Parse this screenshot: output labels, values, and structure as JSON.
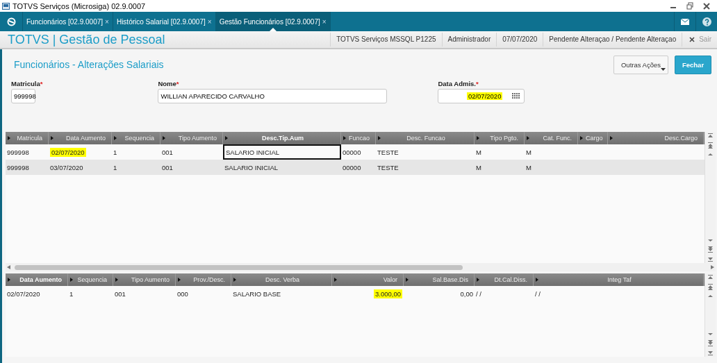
{
  "window": {
    "title": "TOTVS Serviços (Microsiga) 02.9.0007"
  },
  "tabs": [
    {
      "label": "Funcionários [02.9.0007]",
      "close": "×",
      "selected": false
    },
    {
      "label": "Histórico Salarial [02.9.0007]",
      "close": "×",
      "selected": false
    },
    {
      "label": "Gestão Funcionários [02.9.0007]",
      "close": "×",
      "selected": true
    }
  ],
  "app_header": {
    "title": "TOTVS | Gestão de Pessoal",
    "info": [
      "TOTVS Serviços MSSQL P1225",
      "Administrador",
      "07/07/2020",
      "Pendente Alteraçao / Pendente Alteraçao"
    ],
    "exit": "Sair"
  },
  "page": {
    "title": "Funcionários - Alterações Salariais",
    "buttons": [
      {
        "label": "Outras Ações",
        "kind": "menu"
      },
      {
        "label": "Fechar",
        "kind": "primary"
      }
    ]
  },
  "fields": [
    {
      "label": "Matricula",
      "required_mark": "*",
      "value": "999998",
      "highlighted": false,
      "kind": "text"
    },
    {
      "label": "Nome",
      "required_mark": "*",
      "value": "WILLIAN APARECIDO CARVALHO",
      "highlighted": false,
      "kind": "text"
    },
    {
      "label": "Data Admis.",
      "required_mark": "*",
      "value": "02/07/2020",
      "highlighted": true,
      "kind": "date"
    }
  ],
  "grids": [
    {
      "columns": [
        {
          "label": "Matricula",
          "sorted": false
        },
        {
          "label": "Data Aumento",
          "sorted": false
        },
        {
          "label": "Sequencia",
          "sorted": false
        },
        {
          "label": "Tipo Aumento",
          "sorted": false
        },
        {
          "label": "Desc.Tip.Aum",
          "sorted": true
        },
        {
          "label": "Funcao",
          "sorted": false
        },
        {
          "label": "Desc. Funcao",
          "sorted": false
        },
        {
          "label": "Tipo Pgto.",
          "sorted": false
        },
        {
          "label": "Cat. Func.",
          "sorted": false
        },
        {
          "label": "Cargo",
          "sorted": false
        },
        {
          "label": "Desc.Cargo",
          "sorted": false
        }
      ],
      "rows": [
        {
          "cells": [
            {
              "text": "999998",
              "highlighted": false,
              "focused": false
            },
            {
              "text": "02/07/2020",
              "highlighted": true,
              "focused": false
            },
            {
              "text": "1",
              "highlighted": false,
              "focused": false
            },
            {
              "text": "001",
              "highlighted": false,
              "focused": false
            },
            {
              "text": "SALARIO INICIAL",
              "highlighted": false,
              "focused": true
            },
            {
              "text": "00000",
              "highlighted": false,
              "focused": false
            },
            {
              "text": "TESTE",
              "highlighted": false,
              "focused": false
            },
            {
              "text": "M",
              "highlighted": false,
              "focused": false
            },
            {
              "text": "M",
              "highlighted": false,
              "focused": false
            }
          ]
        },
        {
          "cells": [
            {
              "text": "999998",
              "highlighted": false,
              "focused": false
            },
            {
              "text": "03/07/2020",
              "highlighted": false,
              "focused": false
            },
            {
              "text": "1",
              "highlighted": false,
              "focused": false
            },
            {
              "text": "001",
              "highlighted": false,
              "focused": false
            },
            {
              "text": "SALARIO INICIAL",
              "highlighted": false,
              "focused": false
            },
            {
              "text": "00000",
              "highlighted": false,
              "focused": false
            },
            {
              "text": "TESTE",
              "highlighted": false,
              "focused": false
            },
            {
              "text": "M",
              "highlighted": false,
              "focused": false
            },
            {
              "text": "M",
              "highlighted": false,
              "focused": false
            }
          ]
        }
      ]
    },
    {
      "columns": [
        {
          "label": "Data Aumento",
          "sorted": true
        },
        {
          "label": "Sequencia",
          "sorted": false
        },
        {
          "label": "Tipo Aumento",
          "sorted": false
        },
        {
          "label": "Prov./Desc.",
          "sorted": false
        },
        {
          "label": "Desc. Verba",
          "sorted": false
        },
        {
          "label": "Valor",
          "sorted": false
        },
        {
          "label": "Sal.Base.Dis",
          "sorted": false
        },
        {
          "label": "Dt.Cal.Diss.",
          "sorted": false
        },
        {
          "label": "Integ Taf",
          "sorted": false
        }
      ],
      "rows": [
        {
          "cells": [
            {
              "text": "02/07/2020",
              "highlighted": false,
              "focused": false
            },
            {
              "text": "1",
              "highlighted": false,
              "focused": false
            },
            {
              "text": "001",
              "highlighted": false,
              "focused": false
            },
            {
              "text": "000",
              "highlighted": false,
              "focused": false
            },
            {
              "text": "SALARIO BASE",
              "highlighted": false,
              "focused": false
            },
            {
              "text": "3.000,00",
              "highlighted": true,
              "focused": false
            },
            {
              "text": "0,00",
              "highlighted": false,
              "focused": false
            },
            {
              "text": "/ /",
              "highlighted": false,
              "focused": false
            },
            {
              "text": "/ /",
              "highlighted": false,
              "focused": false
            }
          ]
        }
      ]
    }
  ]
}
